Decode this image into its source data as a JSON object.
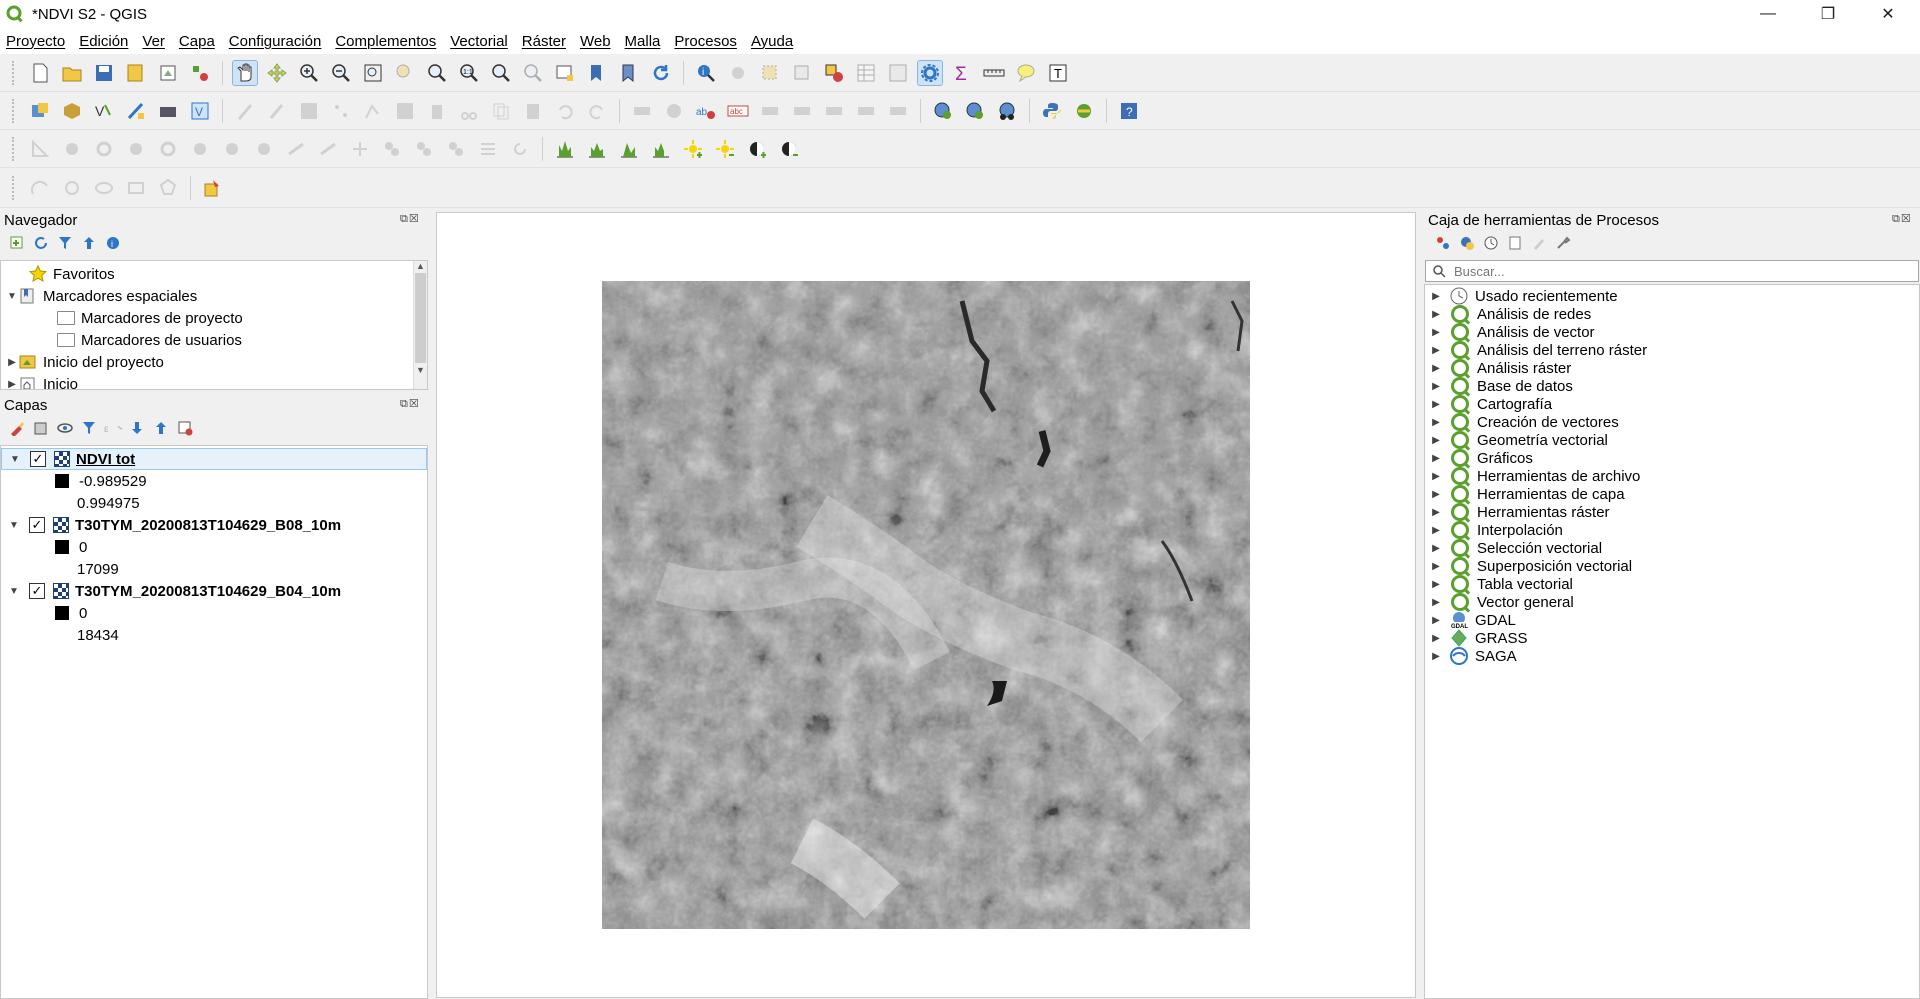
{
  "window": {
    "title": "*NDVI S2 - QGIS",
    "minimize": "—",
    "restore": "❐",
    "close": "✕"
  },
  "menu": [
    "Proyecto",
    "Edición",
    "Ver",
    "Capa",
    "Configuración",
    "Complementos",
    "Vectorial",
    "Ráster",
    "Web",
    "Malla",
    "Procesos",
    "Ayuda"
  ],
  "navigator": {
    "title": "Navegador",
    "items": [
      {
        "label": "Favoritos",
        "icon": "star-icon"
      },
      {
        "label": "Marcadores espaciales",
        "icon": "bookmark-icon"
      },
      {
        "label": "Marcadores de proyecto",
        "icon": "folder-icon"
      },
      {
        "label": "Marcadores de usuarios",
        "icon": "folder-icon"
      },
      {
        "label": "Inicio del proyecto",
        "icon": "project-home-icon"
      },
      {
        "label": "Inicio",
        "icon": "home-icon"
      }
    ]
  },
  "layers": {
    "title": "Capas",
    "items": [
      {
        "name": "NDVI tot",
        "min": "-0.989529",
        "max": "0.994975",
        "checked": true
      },
      {
        "name": "T30TYM_20200813T104629_B08_10m",
        "min": "0",
        "max": "17099",
        "checked": true
      },
      {
        "name": "T30TYM_20200813T104629_B04_10m",
        "min": "0",
        "max": "18434",
        "checked": true
      }
    ]
  },
  "processing": {
    "title": "Caja de herramientas de Procesos",
    "search_placeholder": "Buscar...",
    "items": [
      {
        "label": "Usado recientemente",
        "icon": "clock-icon"
      },
      {
        "label": "Análisis de redes",
        "icon": "qgis-icon"
      },
      {
        "label": "Análisis de vector",
        "icon": "qgis-icon"
      },
      {
        "label": "Análisis del terreno ráster",
        "icon": "qgis-icon"
      },
      {
        "label": "Análisis ráster",
        "icon": "qgis-icon"
      },
      {
        "label": "Base de datos",
        "icon": "qgis-icon"
      },
      {
        "label": "Cartografía",
        "icon": "qgis-icon"
      },
      {
        "label": "Creación de vectores",
        "icon": "qgis-icon"
      },
      {
        "label": "Geometría vectorial",
        "icon": "qgis-icon"
      },
      {
        "label": "Gráficos",
        "icon": "qgis-icon"
      },
      {
        "label": "Herramientas de archivo",
        "icon": "qgis-icon"
      },
      {
        "label": "Herramientas de capa",
        "icon": "qgis-icon"
      },
      {
        "label": "Herramientas ráster",
        "icon": "qgis-icon"
      },
      {
        "label": "Interpolación",
        "icon": "qgis-icon"
      },
      {
        "label": "Selección vectorial",
        "icon": "qgis-icon"
      },
      {
        "label": "Superposición vectorial",
        "icon": "qgis-icon"
      },
      {
        "label": "Tabla vectorial",
        "icon": "qgis-icon"
      },
      {
        "label": "Vector general",
        "icon": "qgis-icon"
      },
      {
        "label": "GDAL",
        "icon": "gdal-icon"
      },
      {
        "label": "GRASS",
        "icon": "grass-icon"
      },
      {
        "label": "SAGA",
        "icon": "saga-icon"
      }
    ]
  },
  "colors": {
    "accent": "#5aa02c",
    "selection": "#cce4f7",
    "raster_dark": "#3a3a3a"
  }
}
